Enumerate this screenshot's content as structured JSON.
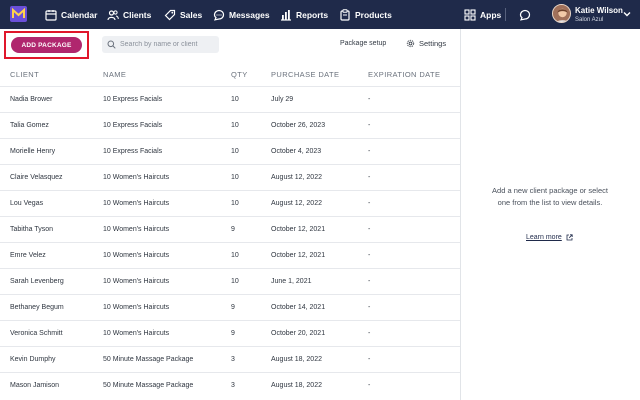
{
  "nav": {
    "items": [
      {
        "label": "Calendar",
        "icon": "calendar-icon"
      },
      {
        "label": "Clients",
        "icon": "clients-icon"
      },
      {
        "label": "Sales",
        "icon": "tag-icon"
      },
      {
        "label": "Messages",
        "icon": "chat-icon"
      },
      {
        "label": "Reports",
        "icon": "bar-chart-icon"
      },
      {
        "label": "Products",
        "icon": "products-icon"
      }
    ],
    "apps_label": "Apps",
    "user": {
      "name": "Katie Wilson",
      "salon": "Salon Azul"
    }
  },
  "toolbar": {
    "add_package_label": "ADD PACKAGE",
    "search_placeholder": "Search by name or client",
    "package_setup_label": "Package setup",
    "settings_label": "Settings"
  },
  "table": {
    "headers": [
      "CLIENT",
      "NAME",
      "QTY",
      "PURCHASE DATE",
      "EXPIRATION DATE"
    ],
    "rows": [
      {
        "client": "Nadia Brower",
        "name": "10 Express Facials",
        "qty": "10",
        "purchase": "July 29",
        "expiration": "-"
      },
      {
        "client": "Talia Gomez",
        "name": "10 Express Facials",
        "qty": "10",
        "purchase": "October 26, 2023",
        "expiration": "-"
      },
      {
        "client": "Morielle Henry",
        "name": "10 Express Facials",
        "qty": "10",
        "purchase": "October 4, 2023",
        "expiration": "-"
      },
      {
        "client": "Claire Velasquez",
        "name": "10 Women's Haircuts",
        "qty": "10",
        "purchase": "August 12, 2022",
        "expiration": "-"
      },
      {
        "client": "Lou Vegas",
        "name": "10 Women's Haircuts",
        "qty": "10",
        "purchase": "August 12, 2022",
        "expiration": "-"
      },
      {
        "client": "Tabitha Tyson",
        "name": "10 Women's Haircuts",
        "qty": "9",
        "purchase": "October 12, 2021",
        "expiration": "-"
      },
      {
        "client": "Emre Velez",
        "name": "10 Women's Haircuts",
        "qty": "10",
        "purchase": "October 12, 2021",
        "expiration": "-"
      },
      {
        "client": "Sarah Levenberg",
        "name": "10 Women's Haircuts",
        "qty": "10",
        "purchase": "June 1, 2021",
        "expiration": "-"
      },
      {
        "client": "Bethaney Begum",
        "name": "10 Women's Haircuts",
        "qty": "9",
        "purchase": "October 14, 2021",
        "expiration": "-"
      },
      {
        "client": "Veronica Schmitt",
        "name": "10 Women's Haircuts",
        "qty": "9",
        "purchase": "October 20, 2021",
        "expiration": "-"
      },
      {
        "client": "Kevin Dumphy",
        "name": "50 Minute Massage Package",
        "qty": "3",
        "purchase": "August 18, 2022",
        "expiration": "-"
      },
      {
        "client": "Mason Jamison",
        "name": "50 Minute Massage Package",
        "qty": "3",
        "purchase": "August 18, 2022",
        "expiration": "-"
      }
    ]
  },
  "detail_panel": {
    "empty_message": "Add a new client package or select one from the list to view details.",
    "learn_more_label": "Learn more"
  },
  "colors": {
    "nav_bg": "#1f2a4a",
    "accent": "#b0266e",
    "highlight_outline": "#e0162b"
  }
}
